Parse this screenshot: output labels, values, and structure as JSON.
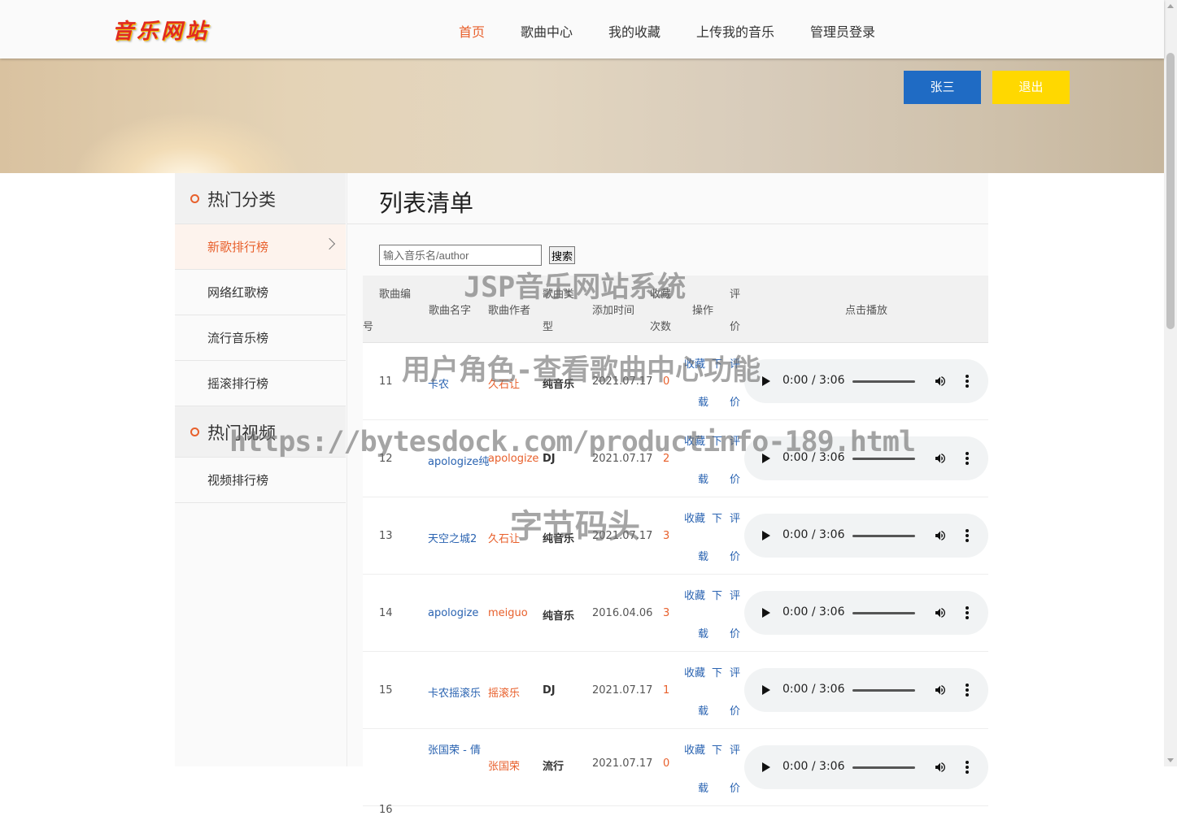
{
  "header": {
    "logo": "音乐网站",
    "nav": [
      "首页",
      "歌曲中心",
      "我的收藏",
      "上传我的音乐",
      "管理员登录"
    ],
    "active_nav": "首页"
  },
  "banner": {
    "user_button": "张三",
    "logout_button": "退出"
  },
  "sidebar": {
    "section1_title": "热门分类",
    "section1_items": [
      "新歌排行榜",
      "网络红歌榜",
      "流行音乐榜",
      "摇滚排行榜"
    ],
    "section2_title": "热门视频",
    "section2_items": [
      "视频排行榜"
    ]
  },
  "main": {
    "title": "列表清单",
    "search_placeholder": "输入音乐名/author",
    "search_button": "搜索",
    "headers": {
      "id_a": "歌曲编",
      "id_b": "号",
      "name": "歌曲名字",
      "author": "歌曲作者",
      "type_a": "歌曲类",
      "type_b": "型",
      "date": "添加时间",
      "fav_a": "收藏",
      "fav_b": "次数",
      "ops": "操作",
      "review_a": "评",
      "review_b": "价",
      "play": "点击播放"
    },
    "ops": {
      "fav": "收藏",
      "dl_a": "下",
      "dl_b": "载",
      "rv_a": "评",
      "rv_b": "价"
    },
    "player_time": "0:00 / 3:06",
    "rows": [
      {
        "id": "11",
        "name": "卡农",
        "author": "久石让",
        "type": "纯音乐",
        "date": "2021.07.17",
        "fav": "0"
      },
      {
        "id": "12",
        "name": "apologize纯",
        "author": "apologize",
        "type": "DJ",
        "date": "2021.07.17",
        "fav": "2"
      },
      {
        "id": "13",
        "name": "天空之城2",
        "author": "久石让",
        "type": "纯音乐",
        "date": "2021.07.17",
        "fav": "3"
      },
      {
        "id": "14",
        "name": "apologize",
        "author": "meiguo",
        "type": "纯音乐",
        "date": "2016.04.06",
        "fav": "3"
      },
      {
        "id": "15",
        "name": "卡农摇滚乐",
        "author": "摇滚乐",
        "type": "DJ",
        "date": "2021.07.17",
        "fav": "1"
      },
      {
        "id": "16",
        "name": "张国荣 - 倩",
        "author": "张国荣",
        "type": "流行",
        "date": "2021.07.17",
        "fav": "0"
      }
    ]
  },
  "watermarks": {
    "w1": "JSP音乐网站系统",
    "w2": "用户角色-查看歌曲中心功能",
    "w3": "https://bytesdock.com/productinfo-189.html",
    "w4": "字节码头"
  }
}
